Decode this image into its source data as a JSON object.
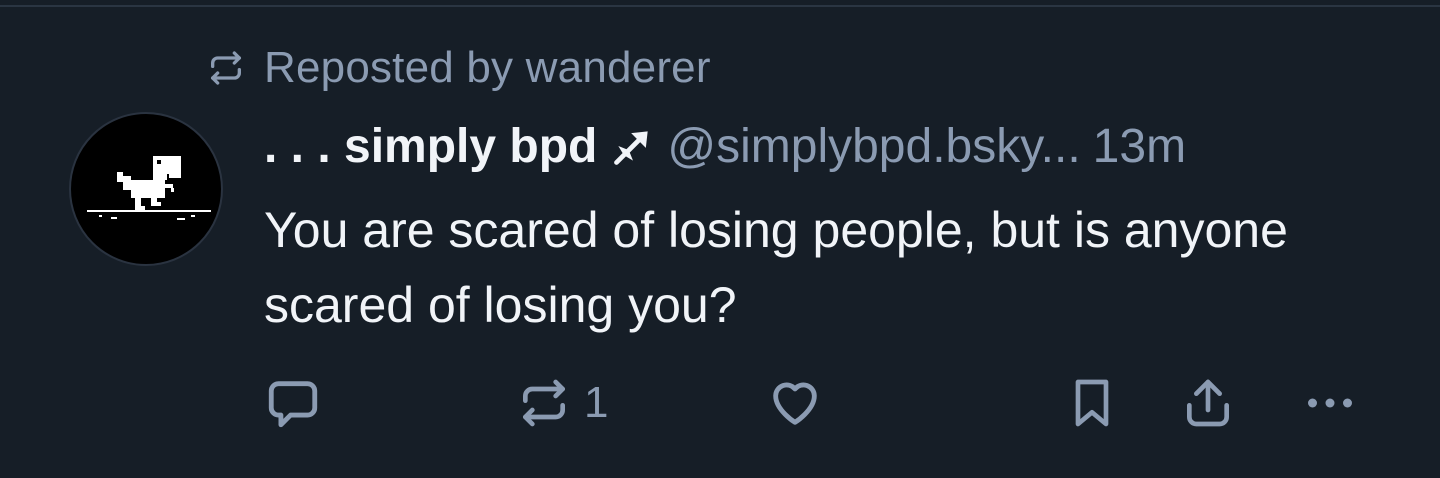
{
  "repost": {
    "icon": "repost-icon",
    "label": "Reposted by wanderer"
  },
  "post": {
    "author_name": ". . . simply bpd",
    "badge_icon": "arrow-badge-icon",
    "handle": "@simplybpd.bsky...",
    "time": "13m",
    "text": "You are scared of losing people, but is anyone scared of losing you?",
    "avatar_icon": "dino-avatar-icon"
  },
  "actions": {
    "reply_icon": "reply-icon",
    "repost_icon": "repost-icon",
    "repost_count": "1",
    "like_icon": "heart-icon",
    "bookmark_icon": "bookmark-icon",
    "share_icon": "share-icon",
    "more_icon": "more-dots-icon"
  },
  "colors": {
    "background": "#161e27",
    "text_primary": "#f1f4f8",
    "text_secondary": "#8b9bb2"
  }
}
